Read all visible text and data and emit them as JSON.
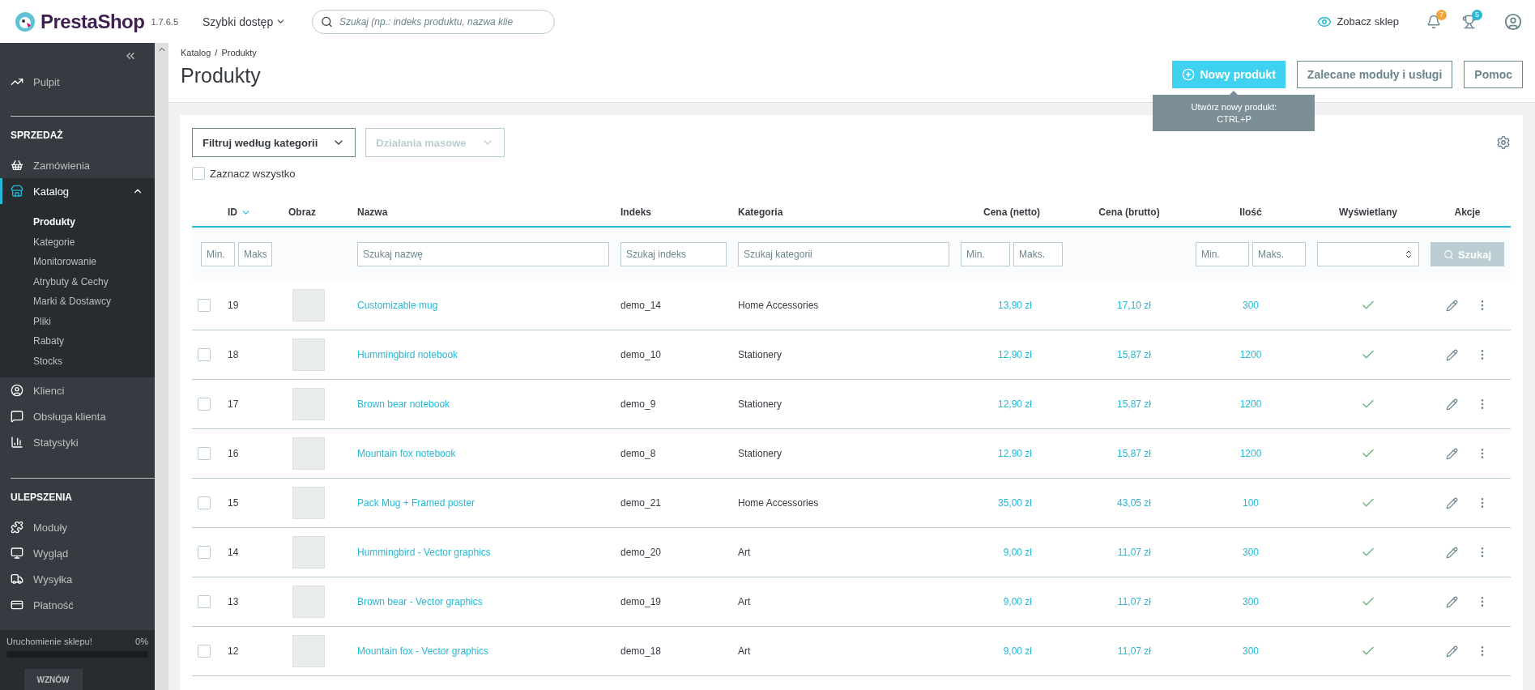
{
  "header": {
    "logo": "PrestaShop",
    "version": "1.7.6.5",
    "quick_access": "Szybki dostęp",
    "search": {
      "placeholder": "Szukaj (np.: indeks produktu, nazwa klie"
    },
    "view_shop": "Zobacz sklep",
    "notifications": [
      {
        "kind": "bell",
        "count": "7",
        "color": "#f2a33a"
      },
      {
        "kind": "trophy",
        "count": "5",
        "color": "#25b9d7"
      }
    ]
  },
  "sidebar": {
    "top": [
      {
        "label": "Pulpit",
        "selected": false
      }
    ],
    "sections": [
      {
        "title": "SPRZEDAŻ",
        "items": [
          {
            "label": "Zamówienia",
            "selected": false
          },
          {
            "label": "Katalog",
            "selected": true,
            "expanded": true,
            "children": [
              {
                "label": "Produkty",
                "selected": true
              },
              {
                "label": "Kategorie",
                "selected": false
              },
              {
                "label": "Monitorowanie",
                "selected": false
              },
              {
                "label": "Atrybuty & Cechy",
                "selected": false
              },
              {
                "label": "Marki & Dostawcy",
                "selected": false
              },
              {
                "label": "Pliki",
                "selected": false
              },
              {
                "label": "Rabaty",
                "selected": false
              },
              {
                "label": "Stocks",
                "selected": false
              }
            ]
          },
          {
            "label": "Klienci",
            "selected": false
          },
          {
            "label": "Obsługa klienta",
            "selected": false
          },
          {
            "label": "Statystyki",
            "selected": false
          }
        ]
      },
      {
        "title": "ULEPSZENIA",
        "items": [
          {
            "label": "Moduły",
            "selected": false
          },
          {
            "label": "Wygląd",
            "selected": false
          },
          {
            "label": "Wysyłka",
            "selected": false
          },
          {
            "label": "Płatność",
            "selected": false
          }
        ]
      }
    ],
    "launch": {
      "label": "Uruchomienie sklepu!",
      "reading": "0%",
      "level": 0,
      "button": "WZNÓW"
    }
  },
  "breadcrumb": {
    "items": [
      "Katalog",
      "Produkty"
    ],
    "separator": "/"
  },
  "title": "Produkty",
  "toolbar": [
    {
      "label": "Nowy produkt",
      "kind": "primary"
    },
    {
      "label": "Zalecane moduły i usługi",
      "kind": "outline"
    },
    {
      "label": "Pomoc",
      "kind": "outline"
    }
  ],
  "tooltip": [
    "Utwórz nowy produkt:",
    "CTRL+P"
  ],
  "filters": [
    {
      "label": "Filtruj według kategorii",
      "disabled": false
    },
    {
      "label": "Działania masowe",
      "disabled": true
    }
  ],
  "select_all": {
    "label": "Zaznacz wszystko",
    "checked": false
  },
  "table": {
    "columns": [
      {
        "label": "ID",
        "sorted": true
      },
      {
        "label": "Obraz",
        "sorted": false
      },
      {
        "label": "Nazwa",
        "sorted": false
      },
      {
        "label": "Indeks",
        "sorted": false
      },
      {
        "label": "Kategoria",
        "sorted": false
      },
      {
        "label": "Cena (netto)",
        "sorted": false
      },
      {
        "label": "Cena (brutto)",
        "sorted": false
      },
      {
        "label": "Ilość",
        "sorted": false
      },
      {
        "label": "Wyświetlany",
        "sorted": false
      },
      {
        "label": "Akcje",
        "sorted": false
      }
    ],
    "filter_row": {
      "id": [
        {
          "placeholder": "Min."
        },
        {
          "placeholder": "Maks"
        }
      ],
      "name": {
        "placeholder": "Szukaj nazwę"
      },
      "index": {
        "placeholder": "Szukaj indeks"
      },
      "category": {
        "placeholder": "Szukaj kategorii"
      },
      "net": [
        {
          "placeholder": "Min."
        },
        {
          "placeholder": "Maks."
        }
      ],
      "qty": [
        {
          "placeholder": "Min."
        },
        {
          "placeholder": "Maks."
        }
      ],
      "search": "Szukaj"
    },
    "rows": [
      {
        "id": "19",
        "name": "Customizable mug",
        "index": "demo_14",
        "category": "Home Accessories",
        "net": "13,90 zł",
        "gross": "17,10 zł",
        "qty": "300",
        "active": true,
        "checked": false
      },
      {
        "id": "18",
        "name": "Hummingbird notebook",
        "index": "demo_10",
        "category": "Stationery",
        "net": "12,90 zł",
        "gross": "15,87 zł",
        "qty": "1200",
        "active": true,
        "checked": false
      },
      {
        "id": "17",
        "name": "Brown bear notebook",
        "index": "demo_9",
        "category": "Stationery",
        "net": "12,90 zł",
        "gross": "15,87 zł",
        "qty": "1200",
        "active": true,
        "checked": false
      },
      {
        "id": "16",
        "name": "Mountain fox notebook",
        "index": "demo_8",
        "category": "Stationery",
        "net": "12,90 zł",
        "gross": "15,87 zł",
        "qty": "1200",
        "active": true,
        "checked": false
      },
      {
        "id": "15",
        "name": "Pack Mug + Framed poster",
        "index": "demo_21",
        "category": "Home Accessories",
        "net": "35,00 zł",
        "gross": "43,05 zł",
        "qty": "100",
        "active": true,
        "checked": false
      },
      {
        "id": "14",
        "name": "Hummingbird - Vector graphics",
        "index": "demo_20",
        "category": "Art",
        "net": "9,00 zł",
        "gross": "11,07 zł",
        "qty": "300",
        "active": true,
        "checked": false
      },
      {
        "id": "13",
        "name": "Brown bear - Vector graphics",
        "index": "demo_19",
        "category": "Art",
        "net": "9,00 zł",
        "gross": "11,07 zł",
        "qty": "300",
        "active": true,
        "checked": false
      },
      {
        "id": "12",
        "name": "Mountain fox - Vector graphics",
        "index": "demo_18",
        "category": "Art",
        "net": "9,00 zł",
        "gross": "11,07 zł",
        "qty": "300",
        "active": true,
        "checked": false
      }
    ]
  }
}
